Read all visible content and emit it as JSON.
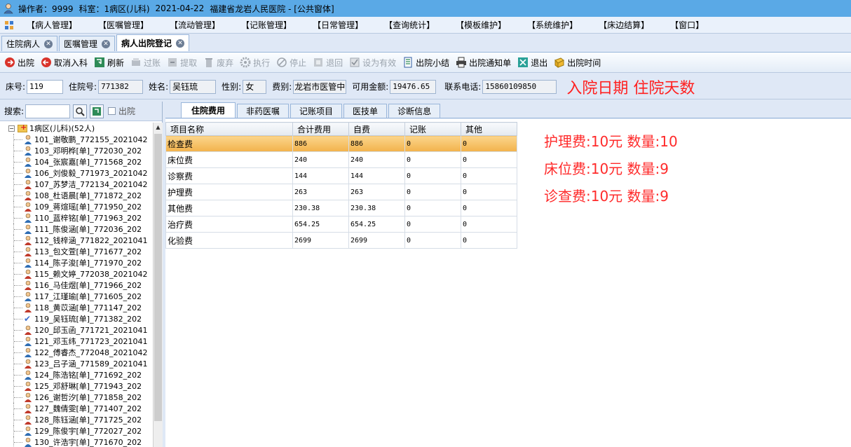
{
  "titlebar": {
    "operator": "操作者：9999",
    "dept": "科室：1病区(儿科)",
    "date": "2021-04-22",
    "hospital": "福建省龙岩人民医院 - [公共窗体]"
  },
  "menu": [
    "【病人管理】",
    "【医嘱管理】",
    "【流动管理】",
    "【记账管理】",
    "【日常管理】",
    "【查询统计】",
    "【模板维护】",
    "【系统维护】",
    "【床边结算】",
    "【窗口】"
  ],
  "doc_tabs": [
    {
      "label": "住院病人",
      "active": false
    },
    {
      "label": "医嘱管理",
      "active": false
    },
    {
      "label": "病人出院登记",
      "active": true
    }
  ],
  "toolbar": [
    {
      "label": "出院",
      "icon": "discharge-icon",
      "disabled": false
    },
    {
      "label": "取消入科",
      "icon": "cancel-admit-icon",
      "disabled": false
    },
    {
      "label": "刷新",
      "icon": "refresh-icon",
      "disabled": false
    },
    {
      "label": "过账",
      "icon": "post-icon",
      "disabled": true
    },
    {
      "label": "提取",
      "icon": "extract-icon",
      "disabled": true
    },
    {
      "label": "废弃",
      "icon": "trash-icon",
      "disabled": true
    },
    {
      "label": "执行",
      "icon": "gear-icon",
      "disabled": true
    },
    {
      "label": "停止",
      "icon": "stop-icon",
      "disabled": true
    },
    {
      "label": "退回",
      "icon": "return-icon",
      "disabled": true
    },
    {
      "label": "设为有效",
      "icon": "validate-icon",
      "disabled": true
    },
    {
      "label": "出院小结",
      "icon": "summary-icon",
      "disabled": false
    },
    {
      "label": "出院通知单",
      "icon": "printer-icon",
      "disabled": false
    },
    {
      "label": "退出",
      "icon": "exit-icon",
      "disabled": false
    },
    {
      "label": "出院时间",
      "icon": "clock-icon",
      "disabled": false
    }
  ],
  "patient": {
    "bed_label": "床号:",
    "bed": "119",
    "inpatient_label": "住院号:",
    "inpatient_no": "771382",
    "name_label": "姓名:",
    "name": "吴钰琉",
    "gender_label": "性别:",
    "gender": "女",
    "fee_type_label": "费别:",
    "fee_type": "龙岩市医管中",
    "balance_label": "可用金额:",
    "balance": "19476.65",
    "phone_label": "联系电话:",
    "phone": "15860109850"
  },
  "annotation_header": "入院日期 住院天数",
  "search": {
    "label": "搜索:",
    "placeholder": "",
    "discharged_label": "出院"
  },
  "tree": {
    "root_label": "1病区(儿科)(52人)",
    "patients": [
      {
        "label": "101_谢敬鹏_772155_2021042",
        "gender": "m",
        "selected": false
      },
      {
        "label": "103_邓明桦[单]_772030_202",
        "gender": "m",
        "selected": false
      },
      {
        "label": "104_张宸嘉[单]_771568_202",
        "gender": "m",
        "selected": false
      },
      {
        "label": "106_刘俊毅_771973_2021042",
        "gender": "m",
        "selected": false
      },
      {
        "label": "107_苏梦洁_772134_2021042",
        "gender": "f",
        "selected": false
      },
      {
        "label": "108_杜语晨[单]_771872_202",
        "gender": "f",
        "selected": false
      },
      {
        "label": "109_蒋煊瑶[单]_771950_202",
        "gender": "f",
        "selected": false
      },
      {
        "label": "110_蓝梓铭[单]_771963_202",
        "gender": "m",
        "selected": false
      },
      {
        "label": "111_陈俊涵[单]_772036_202",
        "gender": "m",
        "selected": false
      },
      {
        "label": "112_钱梓涵_771822_2021041",
        "gender": "f",
        "selected": false
      },
      {
        "label": "113_包文萱[单]_771677_202",
        "gender": "f",
        "selected": false
      },
      {
        "label": "114_陈子浚[单]_771970_202",
        "gender": "m",
        "selected": false
      },
      {
        "label": "115_赖文婷_772038_2021042",
        "gender": "f",
        "selected": false
      },
      {
        "label": "116_马佳煜[单]_771966_202",
        "gender": "f",
        "selected": false
      },
      {
        "label": "117_江瑾瑜[单]_771605_202",
        "gender": "m",
        "selected": false
      },
      {
        "label": "118_黄苡涵[单]_771147_202",
        "gender": "f",
        "selected": false
      },
      {
        "label": "119_吴钰琉[单]_771382_202",
        "gender": "f",
        "selected": true
      },
      {
        "label": "120_邱玉函_771721_2021041",
        "gender": "f",
        "selected": false
      },
      {
        "label": "121_邓玉纬_771723_2021041",
        "gender": "m",
        "selected": false
      },
      {
        "label": "122_傅睿杰_772048_2021042",
        "gender": "m",
        "selected": false
      },
      {
        "label": "123_吕子涵_771589_2021041",
        "gender": "f",
        "selected": false
      },
      {
        "label": "124_陈浩铭[单]_771692_202",
        "gender": "m",
        "selected": false
      },
      {
        "label": "125_邓舒琳[单]_771943_202",
        "gender": "f",
        "selected": false
      },
      {
        "label": "126_谢哲汐[单]_771858_202",
        "gender": "f",
        "selected": false
      },
      {
        "label": "127_魏倩雯[单]_771407_202",
        "gender": "f",
        "selected": false
      },
      {
        "label": "128_陈钰涵[单]_771725_202",
        "gender": "f",
        "selected": false
      },
      {
        "label": "129_陈俊宇[单]_772027_202",
        "gender": "m",
        "selected": false
      },
      {
        "label": "130_许浩宇[单]_771670_202",
        "gender": "m",
        "selected": false
      }
    ]
  },
  "sub_tabs": [
    {
      "label": "住院费用",
      "active": true
    },
    {
      "label": "非药医嘱",
      "active": false
    },
    {
      "label": "记账项目",
      "active": false
    },
    {
      "label": "医技单",
      "active": false
    },
    {
      "label": "诊断信息",
      "active": false
    }
  ],
  "fee_table": {
    "columns": [
      "项目名称",
      "合计费用",
      "自费",
      "记账",
      "其他"
    ],
    "rows": [
      [
        "检查费",
        "886",
        "886",
        "0",
        "0"
      ],
      [
        "床位费",
        "240",
        "240",
        "0",
        "0"
      ],
      [
        "诊察费",
        "144",
        "144",
        "0",
        "0"
      ],
      [
        "护理费",
        "263",
        "263",
        "0",
        "0"
      ],
      [
        "其他费",
        "230.38",
        "230.38",
        "0",
        "0"
      ],
      [
        "治疗费",
        "654.25",
        "654.25",
        "0",
        "0"
      ],
      [
        "化验费",
        "2699",
        "2699",
        "0",
        "0"
      ]
    ],
    "selected_row": 0
  },
  "notes": [
    "护理费:10元  数量:10",
    "床位费:10元  数量:9",
    "诊查费:10元  数量:9"
  ],
  "colors": {
    "title_bar": "#5aa9e6",
    "note_red": "#ff2a2a",
    "selection": "#f2b24c"
  }
}
